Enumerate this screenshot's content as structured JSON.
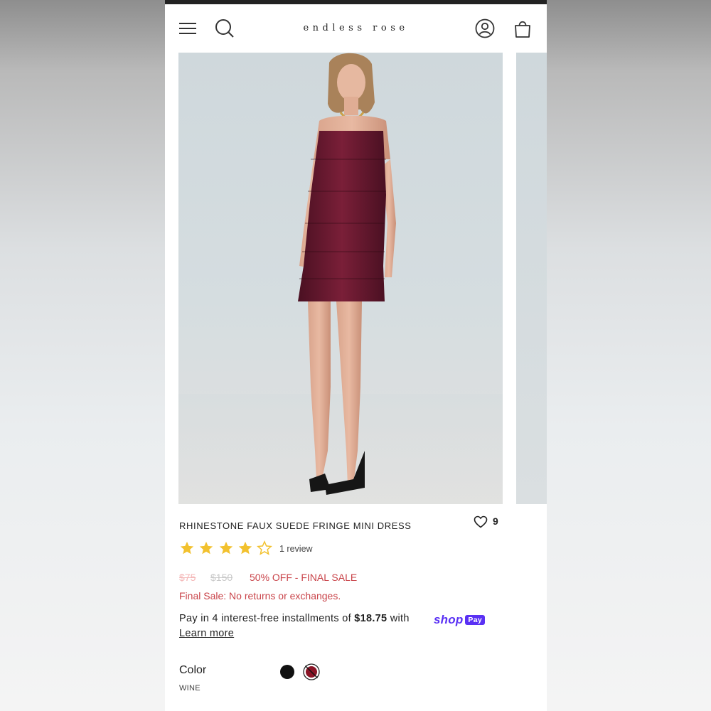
{
  "header": {
    "brand": "endless rose",
    "icons": [
      "menu-icon",
      "search-icon",
      "account-icon",
      "bag-icon"
    ]
  },
  "product": {
    "title": "RHINESTONE FAUX SUEDE FRINGE MINI DRESS",
    "wishlist_count": "9",
    "rating": 4,
    "rating_max": 5,
    "reviews_label": "1 review",
    "price_sale": "$75",
    "price_original": "$150",
    "discount_label": "50% OFF - FINAL SALE",
    "final_sale_note": "Final Sale: No returns or exchanges.",
    "installments": {
      "prefix": "Pay in 4 interest-free installments of ",
      "amount": "$18.75",
      "suffix": " with",
      "shop_word": "shop",
      "pay_badge": "Pay",
      "learn_more": "Learn more"
    },
    "color": {
      "label": "Color",
      "selected": "WINE",
      "swatches": [
        "#111111",
        "#6b1020"
      ]
    }
  },
  "colors": {
    "accent_sale": "#c9444a",
    "star": "#f2c12e",
    "shop_pay": "#5a31f4"
  }
}
